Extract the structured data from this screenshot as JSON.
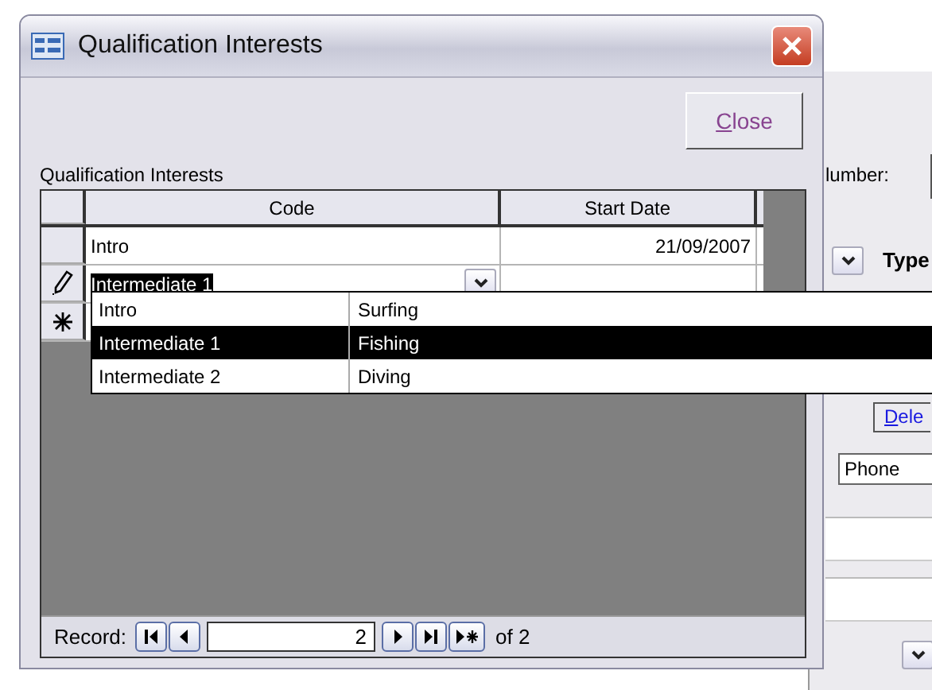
{
  "background_form": {
    "number_label": "lumber:",
    "type_label": "Type",
    "delete_link": {
      "label": "Dele",
      "access_key": true
    },
    "phone_field": "Phone"
  },
  "window": {
    "title": "Qualification Interests",
    "close_button": {
      "label": "Close",
      "access_key": true
    }
  },
  "subform": {
    "label": "Qualification Interests",
    "columns": [
      "Code",
      "Start Date"
    ],
    "rows": [
      {
        "kind": "saved",
        "code": "Intro",
        "start_date": "21/09/2007",
        "text_selected": false
      },
      {
        "kind": "editing",
        "code": "Intermediate 1",
        "text_selected": true,
        "combo": true
      },
      {
        "kind": "new"
      }
    ],
    "dropdown": [
      {
        "code": "Intro",
        "name": "Surfing",
        "selected": false
      },
      {
        "code": "Intermediate 1",
        "name": "Fishing",
        "selected": true
      },
      {
        "code": "Intermediate 2",
        "name": "Diving",
        "selected": false
      }
    ],
    "navigation": {
      "label": "Record:",
      "current": "2",
      "total": "of 2"
    }
  }
}
